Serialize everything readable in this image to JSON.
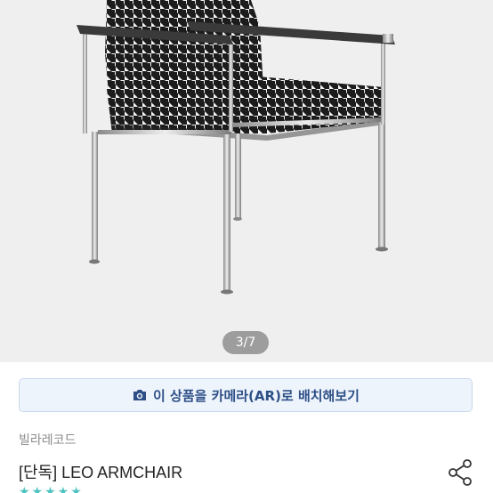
{
  "gallery": {
    "page_indicator": "3/7",
    "background": "#efefef"
  },
  "ar_button": {
    "label": "이 상품을 카메라(AR)로 배치해보기",
    "icon": "camera-icon",
    "accent": "#2d4f86"
  },
  "product": {
    "brand": "빌라레코드",
    "title": "[단독] LEO ARMCHAIR",
    "share_icon": "share-icon",
    "rating_stars": "★★★★★",
    "star_color": "#4fc3c0"
  }
}
